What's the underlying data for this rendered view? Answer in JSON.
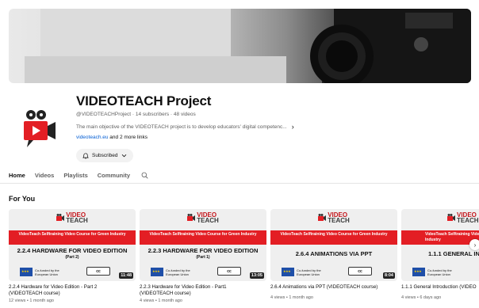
{
  "channel": {
    "name": "VIDEOTEACH Project",
    "meta": "@VIDEOTEACHProject · 14 subscribers · 48 videos",
    "description": "The main objective of the VIDEOTEACH project is to develop educators' digital competenc...",
    "link_text": "videoteach.eu",
    "more_links": " and 2 more links",
    "subscribed_label": "Subscribed"
  },
  "tabs": [
    {
      "label": "Home"
    },
    {
      "label": "Videos"
    },
    {
      "label": "Playlists"
    },
    {
      "label": "Community"
    }
  ],
  "section_title": "For You",
  "videos": [
    {
      "logo": "VIDEO",
      "logo2": "TEACH",
      "band": "VideoTeach Selftraining Video Course for Green Industry",
      "topic": "2.2.4 HARDWARE FOR VIDEO EDITION",
      "part": "(Part 2)",
      "eu": "Co-funded by the European Union",
      "cc": "cc",
      "duration": "11:48",
      "title": "2.2.4 Hardware for Video Edition - Part 2",
      "title2": "(VIDEOTEACH course)",
      "stats": "12 views • 1 month ago"
    },
    {
      "logo": "VIDEO",
      "logo2": "TEACH",
      "band": "VideoTeach Selftraining Video Course for Green Industry",
      "topic": "2.2.3 HARDWARE FOR VIDEO EDITION",
      "part": "(Part 1)",
      "eu": "Co-funded by the European Union",
      "cc": "cc",
      "duration": "13:05",
      "title": "2.2.3 Hardware for Video Edition - Part1",
      "title2": "(VIDEOTEACH course)",
      "stats": "4 views • 1 month ago"
    },
    {
      "logo": "VIDEO",
      "logo2": "TEACH",
      "band": "VideoTeach Selftraining Video Course for Green Industry",
      "topic": "2.6.4 ANIMATIONS VIA PPT",
      "part": "",
      "eu": "Co-funded by the European Union",
      "cc": "cc",
      "duration": "8:04",
      "title": "2.6.4 Animations via PPT (VIDEOTEACH course)",
      "title2": "",
      "stats": "4 views • 1 month ago"
    },
    {
      "logo": "VIDEO",
      "logo2": "TEACH",
      "band": "VideoTeach Selftraining Video Course for Green Industry",
      "topic": "1.1.1 GENERAL INT",
      "part": "",
      "eu": "Co-funded by the European Union",
      "cc": "",
      "duration": "",
      "title": "1.1.1 General Introduction (VIDEO",
      "title2": "",
      "stats": "4 views • 6 days ago"
    }
  ],
  "colors": {
    "brand_red": "#e31e24",
    "link_blue": "#065fd4",
    "eu_blue": "#1f4fa8"
  }
}
